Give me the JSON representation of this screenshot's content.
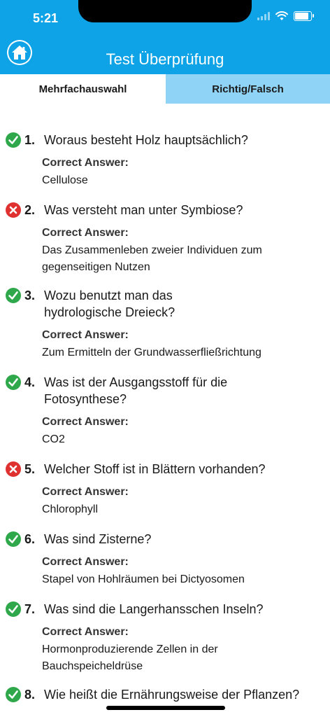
{
  "status_bar": {
    "time": "5:21"
  },
  "header": {
    "title": "Test Überprüfung",
    "home_icon": "home-icon"
  },
  "tabs": [
    {
      "label": "Mehrfachauswahl",
      "active": true
    },
    {
      "label": "Richtig/Falsch",
      "active": false
    }
  ],
  "answer_label": "Correct Answer:",
  "colors": {
    "accent": "#0ea3e6",
    "tab_inactive": "#8fd3f6",
    "correct": "#2ea84a",
    "wrong": "#e03131"
  },
  "questions": [
    {
      "number": "1.",
      "correct": true,
      "question": "Woraus besteht Holz hauptsächlich?",
      "answer": "Cellulose"
    },
    {
      "number": "2.",
      "correct": false,
      "question": "Was versteht man unter Symbiose?",
      "answer": "Das Zusammenleben zweier Individuen zum gegenseitigen Nutzen"
    },
    {
      "number": "3.",
      "correct": true,
      "question": "Wozu benutzt man das hydrologische Dreieck?",
      "answer": "Zum Ermitteln der Grundwasserfließrichtung"
    },
    {
      "number": "4.",
      "correct": true,
      "question": "Was ist der Ausgangsstoff für die Fotosynthese?",
      "answer": "CO2"
    },
    {
      "number": "5.",
      "correct": false,
      "question": "Welcher Stoff ist in Blättern vorhanden?",
      "answer": "Chlorophyll"
    },
    {
      "number": "6.",
      "correct": true,
      "question": "Was sind Zisterne?",
      "answer": "Stapel von Hohlräumen bei Dictyosomen"
    },
    {
      "number": "7.",
      "correct": true,
      "question": "Was sind die Langerhansschen Inseln?",
      "answer": "Hormonproduzierende Zellen in der Bauchspeicheldrüse"
    },
    {
      "number": "8.",
      "correct": true,
      "question": "Wie heißt die Ernährungsweise der Pflanzen?",
      "answer": ""
    }
  ]
}
